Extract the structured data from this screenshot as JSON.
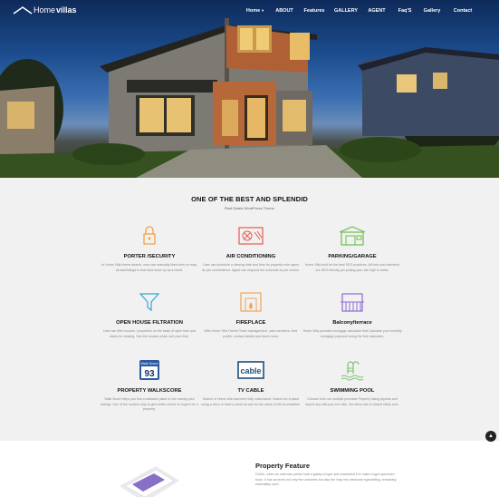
{
  "brand": {
    "prefix": "Home",
    "name": "villas"
  },
  "nav": {
    "items": [
      {
        "label": "Home",
        "caret": "▼"
      },
      {
        "label": "ABOUT"
      },
      {
        "label": "Features"
      },
      {
        "label": "GALLERY"
      },
      {
        "label": "AGENT"
      },
      {
        "label": "Faq'S"
      },
      {
        "label": "Gallery"
      },
      {
        "label": "Contact"
      }
    ]
  },
  "features_section": {
    "title": "ONE OF THE BEST AND SPLENDID",
    "subtitle": "Real Estate WordPress Theme",
    "items": [
      {
        "title": "PORTER /SECURITY",
        "text": "In Home Villa theme search, user can manually likes lines on map, all ads/listings in that area show up as a result.",
        "icon": "lock-icon",
        "color": "#f39c3b"
      },
      {
        "title": "AIR CONDITIONING",
        "text": "User can schedule a viewing date and time for property sofe agent as per convenience. Agent can respond the schedule as per choice.",
        "icon": "air-conditioner-icon",
        "color": "#e85a4f"
      },
      {
        "title": "PARKING/GARAGE",
        "text": "Home Villa built for the best SEO practices. All links and elements are SEO friendly yet putting your site high in ranks.",
        "icon": "garage-icon",
        "color": "#6cbf4b"
      },
      {
        "title": "OPEN HOUSE FILTRATION",
        "text": "User can filter houses / properties on the basis of open time and dates for viewing. See the houses which suit your time.",
        "icon": "filter-icon",
        "color": "#3aa3d8"
      },
      {
        "title": "FIREPLACE",
        "text": "With Home Villa Theme Team management , add members, their profile, contact details and much more.",
        "icon": "fireplace-icon",
        "color": "#f0a35a"
      },
      {
        "title": "Balcony/terrace",
        "text": "Home Villa provides mortgage calculator that Calculate your monthly mortgage payment using the free calculator.",
        "icon": "balcony-icon",
        "color": "#8e6bd6"
      },
      {
        "title": "PROPERTY WALKSCORE",
        "text": "Walk Score helps you find a walkable place to live nearby your listings. One of the modern way to give better choice to buyers for a property.",
        "icon": "walkscore-icon",
        "color": "#2c5aa0",
        "badge_top": "Walk Score",
        "badge_value": "93"
      },
      {
        "title": "TV CABLE",
        "text": "Search in Home villa has been fully customized. Search for a place using a city's or town's name as well as the name of full neccessities.",
        "icon": "tv-cable-icon",
        "color": "#1f4e79",
        "badge_value": "cable"
      },
      {
        "title": "SWIMMING POOL",
        "text": "Choose from our multiple premade Property listing layouts and import any with just one click. Set demo site in lowest clicks ever.",
        "icon": "pool-ladder-icon",
        "color": "#7cc36b"
      }
    ]
  },
  "scroll_top": {
    "glyph": "▲"
  },
  "property": {
    "title": "Property Feature",
    "text": "OhiOs, when an unknown printer took a galley of type and scrambled it to make a type specimen book. It has survived not only five centuries but also the leap into electronic typesetting, remaining essentially unch"
  }
}
